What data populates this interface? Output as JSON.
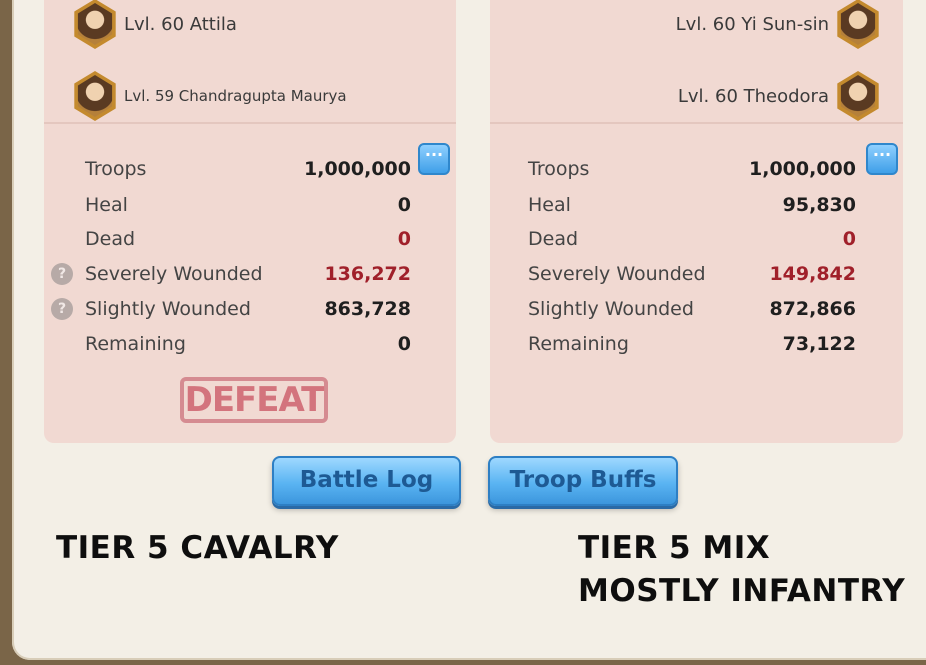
{
  "left": {
    "commanders": [
      {
        "name": "Lvl. 60 Attila"
      },
      {
        "name": "Lvl. 59 Chandragupta Maurya"
      }
    ],
    "stats": [
      {
        "label": "Troops",
        "value": "1,000,000"
      },
      {
        "label": "Heal",
        "value": "0"
      },
      {
        "label": "Dead",
        "value": "0"
      },
      {
        "label": "Severely Wounded",
        "value": "136,272"
      },
      {
        "label": "Slightly Wounded",
        "value": "863,728"
      },
      {
        "label": "Remaining",
        "value": "0"
      }
    ],
    "result": "DEFEAT"
  },
  "right": {
    "commanders": [
      {
        "name": "Lvl. 60 Yi Sun-sin"
      },
      {
        "name": "Lvl. 60 Theodora"
      }
    ],
    "stats": [
      {
        "label": "Troops",
        "value": "1,000,000"
      },
      {
        "label": "Heal",
        "value": "95,830"
      },
      {
        "label": "Dead",
        "value": "0"
      },
      {
        "label": "Severely Wounded",
        "value": "149,842"
      },
      {
        "label": "Slightly Wounded",
        "value": "872,866"
      },
      {
        "label": "Remaining",
        "value": "73,122"
      }
    ]
  },
  "buttons": {
    "battle_log": "Battle Log",
    "troop_buffs": "Troop Buffs",
    "more": "···",
    "help": "?"
  },
  "captions": {
    "left": "TIER 5 CAVALRY",
    "right_line1": "TIER 5 MIX",
    "right_line2": "MOSTLY INFANTRY"
  },
  "colors": {
    "panel": "#f1d9d2",
    "red_value": "#a0202a",
    "button_blue": "#5ab4f2"
  }
}
